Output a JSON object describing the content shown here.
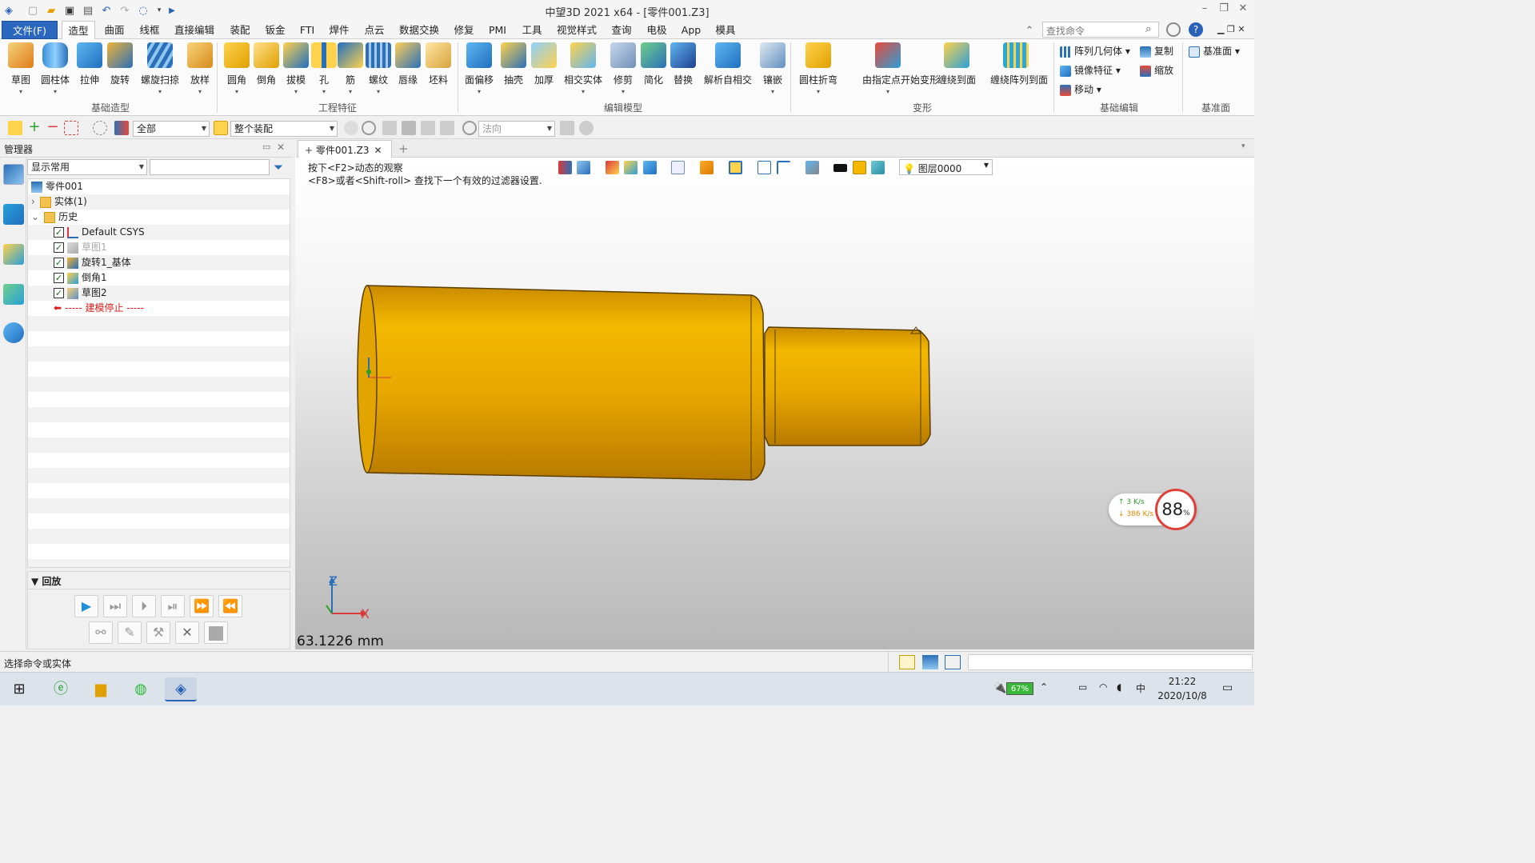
{
  "window": {
    "title": "中望3D 2021 x64 - [零件001.Z3]",
    "min_label": "–",
    "max_label": "❐",
    "close_label": "✕"
  },
  "menu": {
    "file": "文件(F)",
    "tabs": [
      "造型",
      "曲面",
      "线框",
      "直接编辑",
      "装配",
      "钣金",
      "FTI",
      "焊件",
      "点云",
      "数据交换",
      "修复",
      "PMI",
      "工具",
      "视觉样式",
      "查询",
      "电极",
      "App",
      "模具"
    ],
    "active": "造型"
  },
  "search": {
    "placeholder": "查找命令"
  },
  "ribbon": {
    "base_shapes": [
      "草图",
      "圆柱体",
      "拉伸",
      "旋转",
      "螺旋扫掠",
      "放样"
    ],
    "eng_features": [
      "圆角",
      "倒角",
      "拔模",
      "孔",
      "筋",
      "螺纹",
      "唇缘",
      "坯料"
    ],
    "edit_model": [
      "面偏移",
      "抽壳",
      "加厚",
      "相交实体",
      "修剪",
      "简化",
      "替换",
      "解析自相交",
      "镶嵌"
    ],
    "deform": [
      "圆柱折弯",
      "由指定点开始变形",
      "缠绕到面",
      "缠绕阵列到面"
    ],
    "basic_edit": [
      "阵列几何体",
      "复制",
      "镜像特征",
      "缩放",
      "移动"
    ],
    "datum": [
      "基准面"
    ],
    "groups": [
      "基础造型",
      "工程特征",
      "编辑模型",
      "变形",
      "基础编辑",
      "基准面"
    ]
  },
  "toolbar2": {
    "filter_all": "全部",
    "assembly_scope": "整个装配",
    "direction_placeholder": "法向"
  },
  "manager": {
    "title": "管理器",
    "display_combo": "显示常用",
    "tree": [
      {
        "label": "零件001",
        "level": 0,
        "checked": false
      },
      {
        "label": "实体(1)",
        "level": 1,
        "checked": false
      },
      {
        "label": "历史",
        "level": 1,
        "checked": false
      },
      {
        "label": "Default CSYS",
        "level": 2,
        "checked": true
      },
      {
        "label": "草图1",
        "level": 2,
        "checked": true,
        "dim": true
      },
      {
        "label": "旋转1_基体",
        "level": 2,
        "checked": true
      },
      {
        "label": "倒角1",
        "level": 2,
        "checked": true
      },
      {
        "label": "草图2",
        "level": 2,
        "checked": true
      },
      {
        "label": "----- 建模停止 -----",
        "level": 2,
        "stop": true
      }
    ],
    "playback_title": "回放"
  },
  "doc_tab": {
    "label": "零件001.Z3"
  },
  "viewport": {
    "hint_line1": "按下<F2>动态的观察",
    "hint_line2": "<F8>或者<Shift-roll> 查找下一个有效的过滤器设置.",
    "layer": "图层0000",
    "measure": "63.1226 mm",
    "axis_x": "X",
    "axis_z": "Z",
    "part_color": "#e8a800"
  },
  "net_widget": {
    "up": "3  K/s",
    "down": "386 K/s",
    "percent": "88",
    "percent_sign": "%"
  },
  "status": {
    "prompt": "选择命令或实体"
  },
  "taskbar": {
    "battery": "67%",
    "time": "21:22",
    "date": "2020/10/8"
  }
}
